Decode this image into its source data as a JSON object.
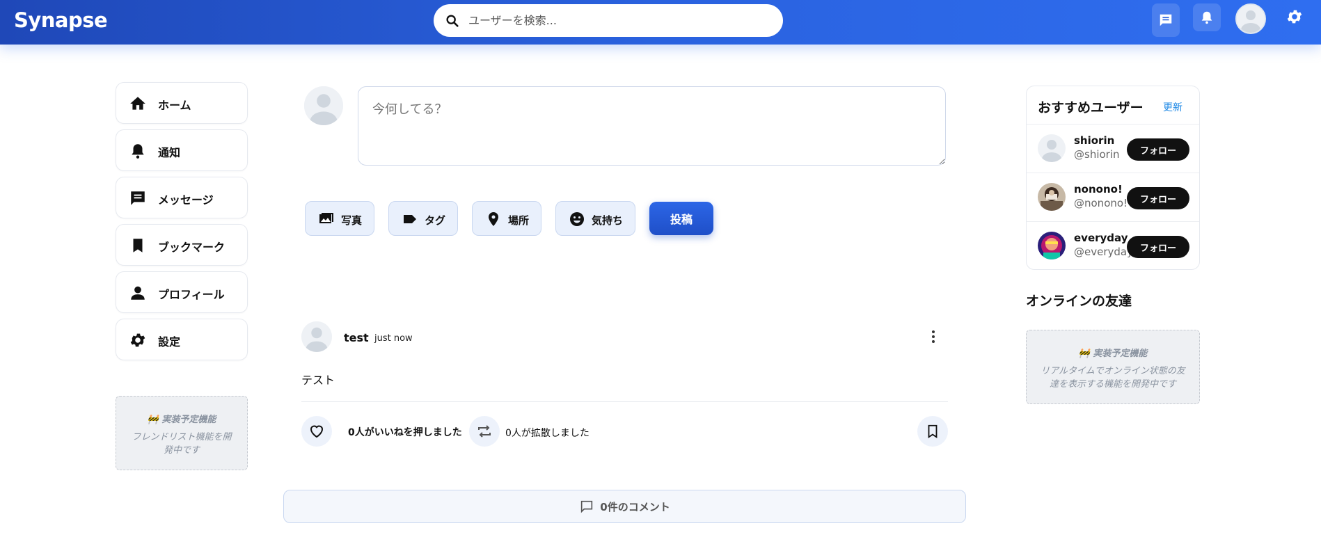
{
  "header": {
    "logo": "Synapse",
    "search_placeholder": "ユーザーを検索..."
  },
  "nav": {
    "items": [
      {
        "label": "ホーム",
        "icon": "home-icon"
      },
      {
        "label": "通知",
        "icon": "bell-icon"
      },
      {
        "label": "メッセージ",
        "icon": "message-icon"
      },
      {
        "label": "ブックマーク",
        "icon": "bookmark-icon"
      },
      {
        "label": "プロフィール",
        "icon": "person-icon"
      },
      {
        "label": "設定",
        "icon": "gear-icon"
      }
    ],
    "friend_list_notice": {
      "title": "🚧 実装予定機能",
      "desc": "フレンドリスト機能を開発中です"
    }
  },
  "composer": {
    "placeholder": "今何してる？",
    "chips": [
      {
        "label": "写真",
        "icon": "photo-icon"
      },
      {
        "label": "タグ",
        "icon": "tag-icon"
      },
      {
        "label": "場所",
        "icon": "location-icon"
      },
      {
        "label": "気持ち",
        "icon": "emoji-icon"
      }
    ],
    "post_label": "投稿"
  },
  "post": {
    "author": "test",
    "time": "just now",
    "body": "テスト",
    "likes_label": "0人がいいねを押しました",
    "reposts_label": "0人が拡散しました",
    "comments_label": "0件のコメント"
  },
  "recommend": {
    "title": "おすすめユーザー",
    "refresh_label": "更新",
    "follow_label": "フォロー",
    "users": [
      {
        "name": "shiorin",
        "handle": "@shiorin"
      },
      {
        "name": "nonono!",
        "handle": "@nonono!"
      },
      {
        "name": "everyday",
        "handle": "@everyday"
      }
    ]
  },
  "online": {
    "title": "オンラインの友達",
    "notice_title": "🚧 実装予定機能",
    "notice_desc": "リアルタイムでオンライン状態の友達を表示する機能を開発中です"
  },
  "colors": {
    "header_start": "#1f48b8",
    "header_end": "#2f6ef0",
    "accent": "#1f4fc8",
    "link": "#1e88e5"
  }
}
